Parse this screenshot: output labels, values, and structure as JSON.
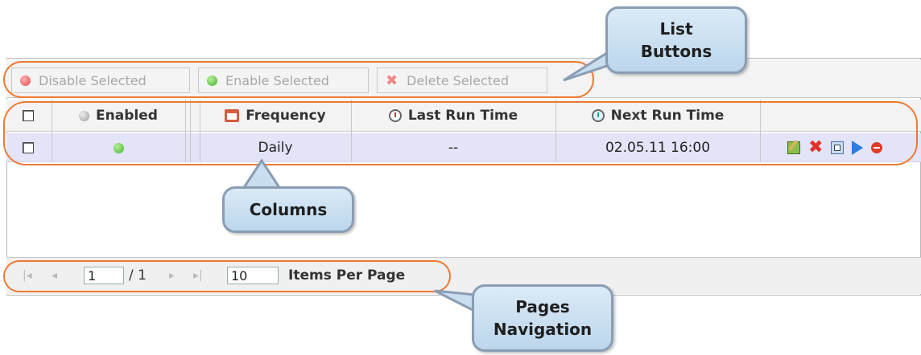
{
  "toolbar": {
    "disable_selected": "Disable Selected",
    "enable_selected": "Enable Selected",
    "delete_selected": "Delete Selected"
  },
  "columns": {
    "enabled": "Enabled",
    "frequency": "Frequency",
    "last_run_time": "Last Run Time",
    "next_run_time": "Next Run Time"
  },
  "rows": [
    {
      "frequency": "Daily",
      "last_run_time": "--",
      "next_run_time": "02.05.11 16:00"
    }
  ],
  "pager": {
    "current_page": "1",
    "total_pages": "/ 1",
    "items_per_page": "10",
    "items_per_page_label": "Items Per Page"
  },
  "callouts": {
    "list_buttons_1": "List",
    "list_buttons_2": "Buttons",
    "columns": "Columns",
    "pages_navigation_1": "Pages",
    "pages_navigation_2": "Navigation"
  },
  "colors": {
    "highlight_oval": "#ee7a33",
    "row_selected_bg": "#e3e4f7",
    "callout_fill": "#c9dff0"
  },
  "icons": [
    "red-dot-icon",
    "green-dot-icon",
    "delete-x-icon",
    "enabled-dot-icon",
    "calendar-icon",
    "last-run-clock-icon",
    "next-run-clock-icon",
    "edit-icon",
    "delete-icon",
    "view-icon",
    "run-icon",
    "stop-icon"
  ]
}
